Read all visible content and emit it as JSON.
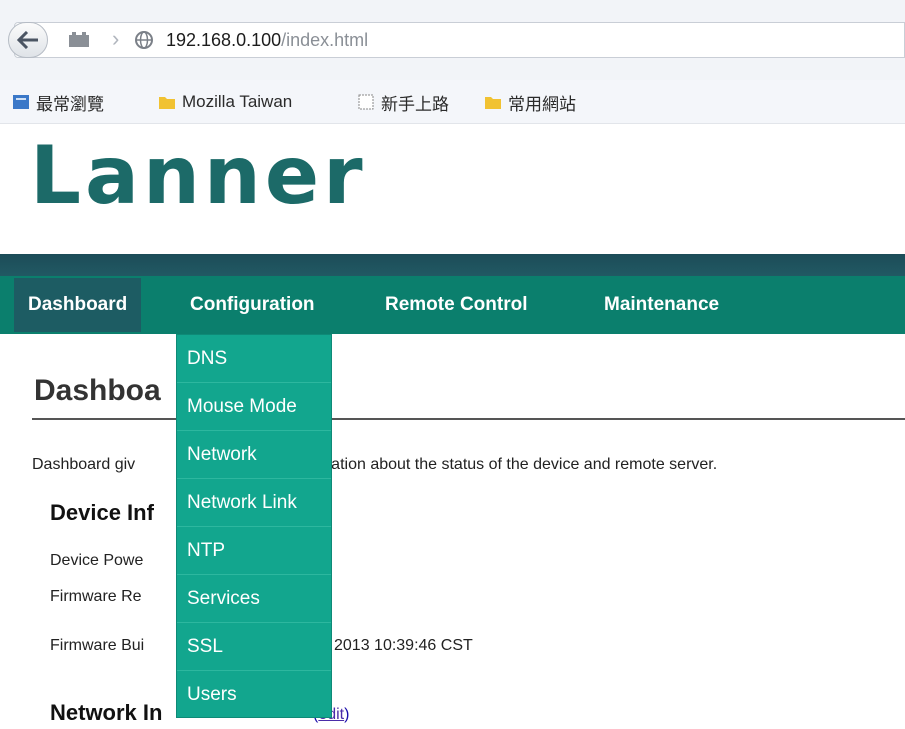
{
  "browser": {
    "url_host": "192.168.0.100",
    "url_path": "/index.html",
    "bookmarks": [
      {
        "label": "最常瀏覽",
        "icon": "page-icon"
      },
      {
        "label": "Mozilla Taiwan",
        "icon": "folder-icon"
      },
      {
        "label": "新手上路",
        "icon": "blank-page-icon"
      },
      {
        "label": "常用網站",
        "icon": "folder-icon"
      }
    ]
  },
  "logo": {
    "text": "Lanner"
  },
  "nav": {
    "items": [
      "Dashboard",
      "Configuration",
      "Remote Control",
      "Maintenance"
    ]
  },
  "dropdown": {
    "items": [
      "DNS",
      "Mouse Mode",
      "Network",
      "Network Link",
      "NTP",
      "Services",
      "SSL",
      "Users"
    ]
  },
  "page": {
    "title_visible": "Dashboa",
    "intro_left": "Dashboard giv",
    "intro_right": "formation about the status of the device and remote server.",
    "device_section": "Device Inf",
    "rows": [
      {
        "label": "Device Powe"
      },
      {
        "label": "Firmware Re"
      },
      {
        "label": "Firmware Bui",
        "value": "2013 10:39:46 CST"
      }
    ],
    "network_section": "Network In",
    "edit_link": "edit"
  },
  "colors": {
    "brand_teal": "#1c6a68",
    "nav_bg": "#0b7f6d",
    "dropdown_bg": "#12a68e"
  }
}
